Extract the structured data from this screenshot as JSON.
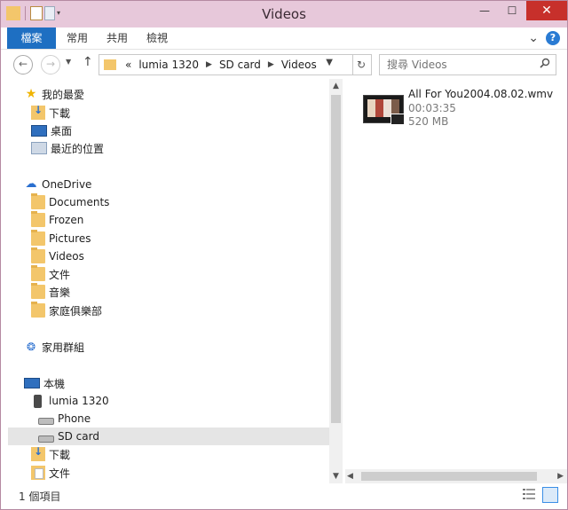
{
  "window": {
    "title": "Videos"
  },
  "titlebar": {
    "minimize_glyph": "—",
    "maximize_glyph": "☐",
    "close_glyph": "✕"
  },
  "ribbon": {
    "tabs": [
      {
        "label": "檔案",
        "active": true
      },
      {
        "label": "常用"
      },
      {
        "label": "共用"
      },
      {
        "label": "檢視"
      }
    ],
    "expand_glyph": "⌄",
    "help_glyph": "?"
  },
  "address": {
    "overflow": "«",
    "crumbs": [
      "lumia 1320",
      "SD card",
      "Videos"
    ]
  },
  "search": {
    "placeholder": "搜尋 Videos"
  },
  "nav": {
    "favorites": {
      "label": "我的最愛",
      "items": [
        {
          "label": "下載",
          "icon": "downloads-icon"
        },
        {
          "label": "桌面",
          "icon": "desktop-icon"
        },
        {
          "label": "最近的位置",
          "icon": "recent-places-icon"
        }
      ]
    },
    "onedrive": {
      "label": "OneDrive",
      "items": [
        {
          "label": "Documents"
        },
        {
          "label": "Frozen"
        },
        {
          "label": "Pictures"
        },
        {
          "label": "Videos"
        },
        {
          "label": "文件"
        },
        {
          "label": "音樂"
        },
        {
          "label": "家庭俱樂部"
        }
      ]
    },
    "homegroup": {
      "label": "家用群組"
    },
    "thispc": {
      "label": "本機",
      "device": "lumia 1320",
      "drives": [
        {
          "label": "Phone"
        },
        {
          "label": "SD card",
          "selected": true
        }
      ],
      "items": [
        {
          "label": "下載"
        },
        {
          "label": "文件"
        }
      ]
    }
  },
  "content": {
    "files": [
      {
        "name": "All For You2004.08.02.wmv",
        "duration": "00:03:35",
        "size": "520 MB"
      }
    ]
  },
  "status": {
    "item_count": "1 個項目"
  },
  "colors": {
    "accent": "#1e6fc2",
    "titlebar": "#e7c8da",
    "close": "#c7302b"
  }
}
